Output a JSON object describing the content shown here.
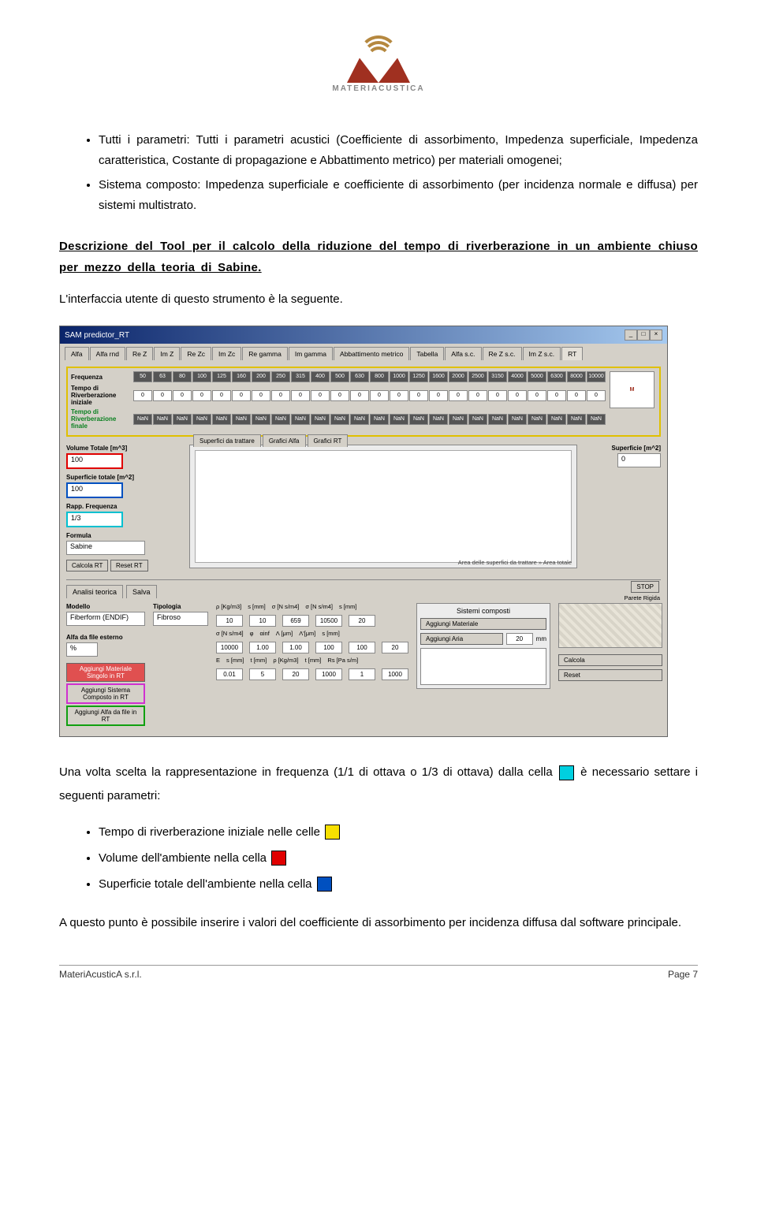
{
  "logo_text": "MATERIACUSTICA",
  "bullet_list_1": [
    "Tutti i parametri: Tutti i parametri acustici (Coefficiente di assorbimento, Impedenza superficiale, Impedenza caratteristica, Costante di propagazione e Abbattimento metrico) per materiali omogenei;",
    "Sistema composto: Impedenza superficiale e coefficiente di assorbimento (per incidenza normale e diffusa) per sistemi multistrato."
  ],
  "section_title": "Descrizione del Tool per il calcolo della riduzione del tempo di riverberazione in un ambiente chiuso per mezzo della teoria di Sabine.",
  "intro_text": "L'interfaccia utente di questo strumento è la seguente.",
  "screenshot": {
    "title": "SAM predictor_RT",
    "tabs": [
      "Alfa",
      "Alfa rnd",
      "Re Z",
      "Im Z",
      "Re Zc",
      "Im Zc",
      "Re gamma",
      "Im gamma",
      "Abbattimento metrico",
      "Tabella",
      "Alfa s.c.",
      "Re Z s.c.",
      "Im Z s.c.",
      "RT"
    ],
    "freq_label": "Frequenza",
    "freq_values": [
      "50",
      "63",
      "80",
      "100",
      "125",
      "160",
      "200",
      "250",
      "315",
      "400",
      "500",
      "630",
      "800",
      "1000",
      "1250",
      "1600",
      "2000",
      "2500",
      "3150",
      "4000",
      "5000",
      "6300",
      "8000",
      "10000"
    ],
    "tempo_iniziale_label": "Tempo di Riverberazione iniziale",
    "tempo_iniziale_values": [
      "0",
      "0",
      "0",
      "0",
      "0",
      "0",
      "0",
      "0",
      "0",
      "0",
      "0",
      "0",
      "0",
      "0",
      "0",
      "0",
      "0",
      "0",
      "0",
      "0",
      "0",
      "0",
      "0",
      "0"
    ],
    "tempo_finale_label": "Tempo di Riverberazione finale",
    "tempo_finale_values": [
      "NaN",
      "NaN",
      "NaN",
      "NaN",
      "NaN",
      "NaN",
      "NaN",
      "NaN",
      "NaN",
      "NaN",
      "NaN",
      "NaN",
      "NaN",
      "NaN",
      "NaN",
      "NaN",
      "NaN",
      "NaN",
      "NaN",
      "NaN",
      "NaN",
      "NaN",
      "NaN",
      "NaN"
    ],
    "volume_label": "Volume Totale [m^3]",
    "volume_value": "100",
    "superficie_tot_label": "Superficie totale [m^2]",
    "superficie_tot_value": "100",
    "rapp_freq_label": "Rapp. Frequenza",
    "rapp_freq_value": "1/3",
    "formula_label": "Formula",
    "formula_value": "Sabine",
    "btn_calcola_rt": "Calcola RT",
    "btn_reset_rt": "Reset RT",
    "graph_tabs": [
      "Superfici da trattare",
      "Grafici Alfa",
      "Grafici RT"
    ],
    "superficie_label": "Superficie [m^2]",
    "superficie_value": "0",
    "graph_footer": "Area delle superfici da trattare » Area totale",
    "stop_label": "STOP",
    "analisi_tabs": [
      "Analisi teorica",
      "Salva"
    ],
    "modello_label": "Modello",
    "modello_value": "Fiberform (ENDIF)",
    "tipologia_label": "Tipologia",
    "tipologia_value": "Fibroso",
    "alfa_file_label": "Alfa da file esterno",
    "alfa_file_value": "%",
    "param_heads_1": [
      "ρ [Kg/m3]",
      "s [mm]",
      "σ [N s/m4]",
      "σ [N s/m4]",
      "s [mm]"
    ],
    "param_vals_1": [
      "10",
      "10",
      "659",
      "10500",
      "20"
    ],
    "param_heads_2": [
      "σ [N s/m4]",
      "φ",
      "αinf",
      "Λ [μm]",
      "Λ'[μm]",
      "s [mm]"
    ],
    "param_vals_2": [
      "10000",
      "1.00",
      "1.00",
      "100",
      "100",
      "20"
    ],
    "param_heads_3": [
      "E",
      "s [mm]",
      "t [mm]",
      "ρ [Kg/m3]",
      "t [mm]",
      "Rs [Pa s/m]"
    ],
    "param_vals_3": [
      "0.01",
      "5",
      "20",
      "1000",
      "1",
      "1000"
    ],
    "btn_color_1": "Aggiungi Materiale Singolo in RT",
    "btn_color_2": "Aggiungi Sistema Composto in RT",
    "btn_color_3": "Aggiungi Alfa da file in RT",
    "sistemi_title": "Sistemi composti",
    "btn_agg_mat": "Aggiungi Materiale",
    "btn_agg_aria": "Aggiungi Aria",
    "aria_value": "20",
    "aria_unit": "mm",
    "parete_label": "Parete Rigida",
    "btn_calcola": "Calcola",
    "btn_reset": "Reset"
  },
  "after_para": {
    "p1a": "Una volta scelta la rappresentazione in frequenza (1/1 di ottava o 1/3 di ottava) dalla cella ",
    "p1b": " è necessario settare i seguenti parametri:"
  },
  "bullet_list_2": {
    "b1": "Tempo di riverberazione iniziale nelle celle ",
    "b2": "Volume dell'ambiente nella cella ",
    "b3": "Superficie totale dell'ambiente nella cella "
  },
  "closing_para": "A questo punto è possibile inserire i valori del coefficiente di assorbimento per incidenza diffusa dal software principale.",
  "footer_left": "MateriAcusticA s.r.l.",
  "footer_right": "Page 7"
}
